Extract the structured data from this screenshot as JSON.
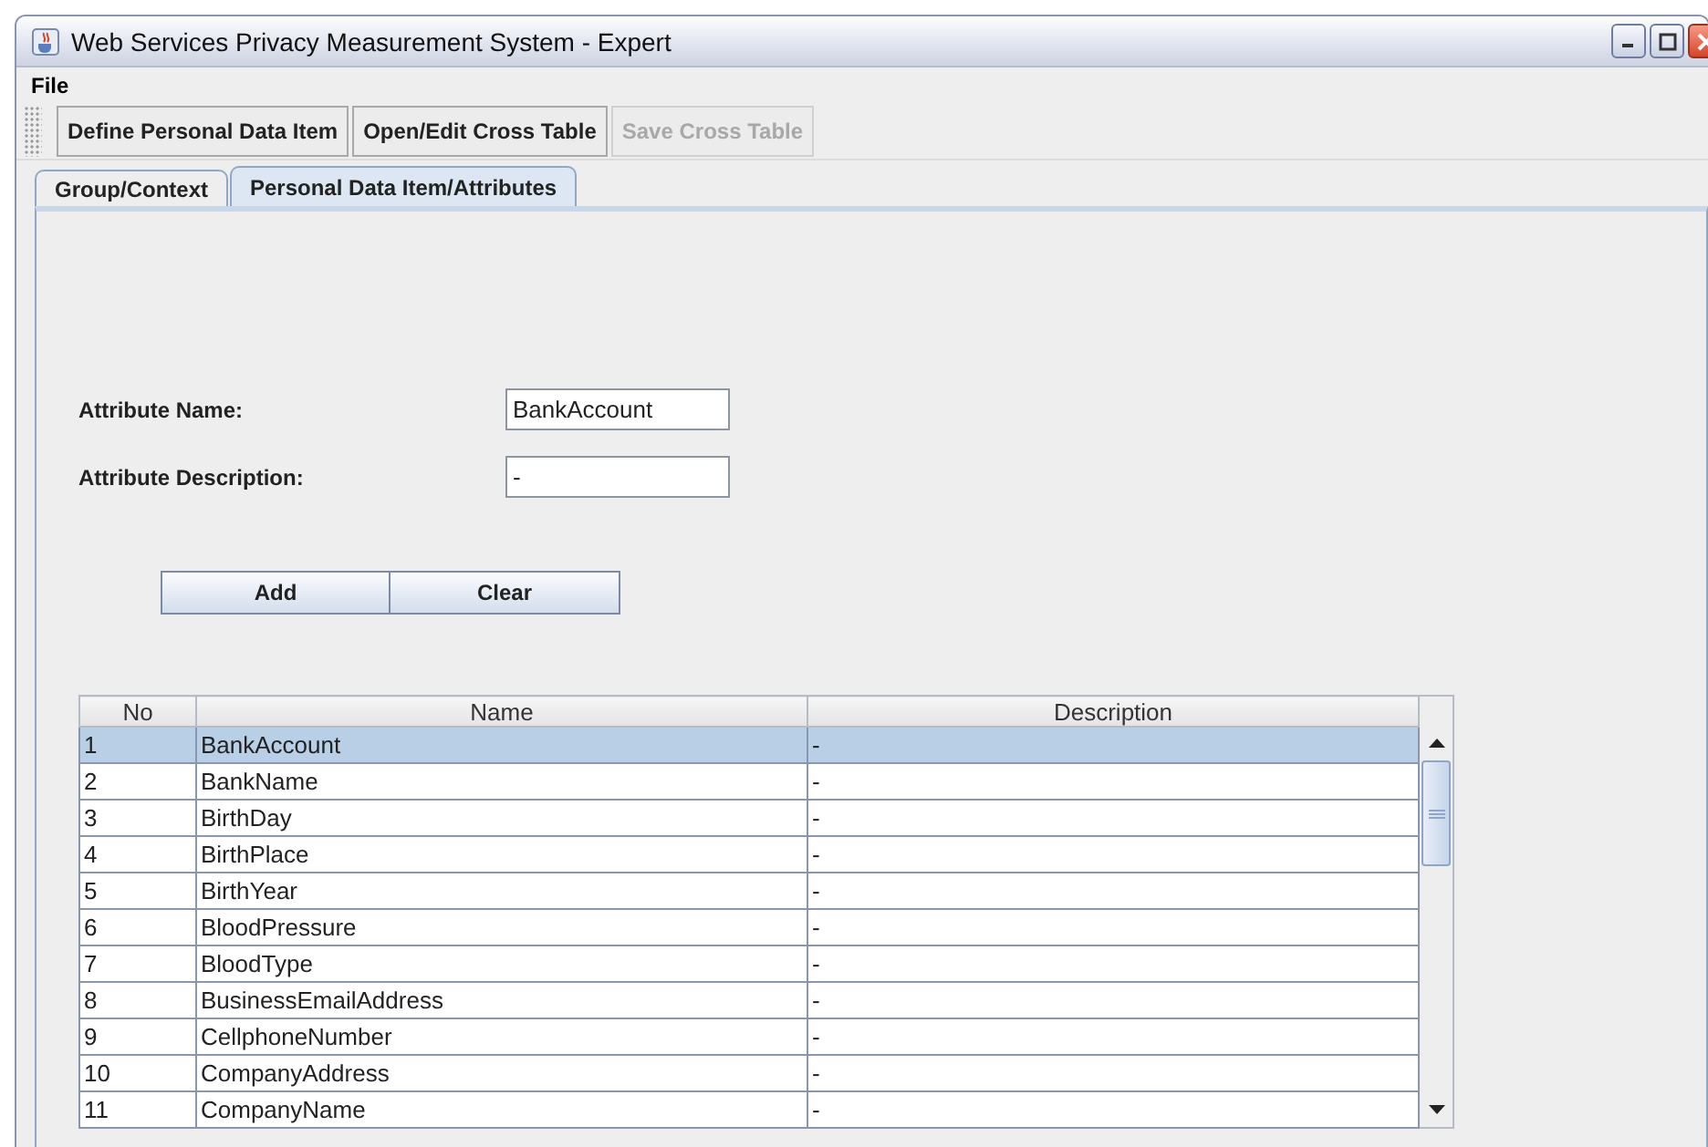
{
  "window": {
    "title": "Web Services Privacy Measurement System - Expert"
  },
  "menu": [
    "File"
  ],
  "toolbar": [
    {
      "label": "Define Personal Data Item",
      "disabled": false
    },
    {
      "label": "Open/Edit Cross Table",
      "disabled": false
    },
    {
      "label": "Save Cross Table",
      "disabled": true
    }
  ],
  "tabs": [
    {
      "label": "Group/Context",
      "selected": false
    },
    {
      "label": "Personal Data Item/Attributes",
      "selected": true
    }
  ],
  "form": {
    "fields": [
      {
        "label": "Attribute Name:",
        "value": "BankAccount"
      },
      {
        "label": "Attribute Description:",
        "value": "-"
      }
    ],
    "buttons": [
      "Add",
      "Clear"
    ]
  },
  "table": {
    "columns": [
      "No",
      "Name",
      "Description"
    ],
    "rows": [
      {
        "cells": [
          "1",
          "BankAccount",
          "-"
        ],
        "selected": true
      },
      {
        "cells": [
          "2",
          "BankName",
          "-"
        ],
        "selected": false
      },
      {
        "cells": [
          "3",
          "BirthDay",
          "-"
        ],
        "selected": false
      },
      {
        "cells": [
          "4",
          "BirthPlace",
          "-"
        ],
        "selected": false
      },
      {
        "cells": [
          "5",
          "BirthYear",
          "-"
        ],
        "selected": false
      },
      {
        "cells": [
          "6",
          "BloodPressure",
          "-"
        ],
        "selected": false
      },
      {
        "cells": [
          "7",
          "BloodType",
          "-"
        ],
        "selected": false
      },
      {
        "cells": [
          "8",
          "BusinessEmailAddress",
          "-"
        ],
        "selected": false
      },
      {
        "cells": [
          "9",
          "CellphoneNumber",
          "-"
        ],
        "selected": false
      },
      {
        "cells": [
          "10",
          "CompanyAddress",
          "-"
        ],
        "selected": false
      },
      {
        "cells": [
          "11",
          "CompanyName",
          "-"
        ],
        "selected": false
      }
    ]
  }
}
